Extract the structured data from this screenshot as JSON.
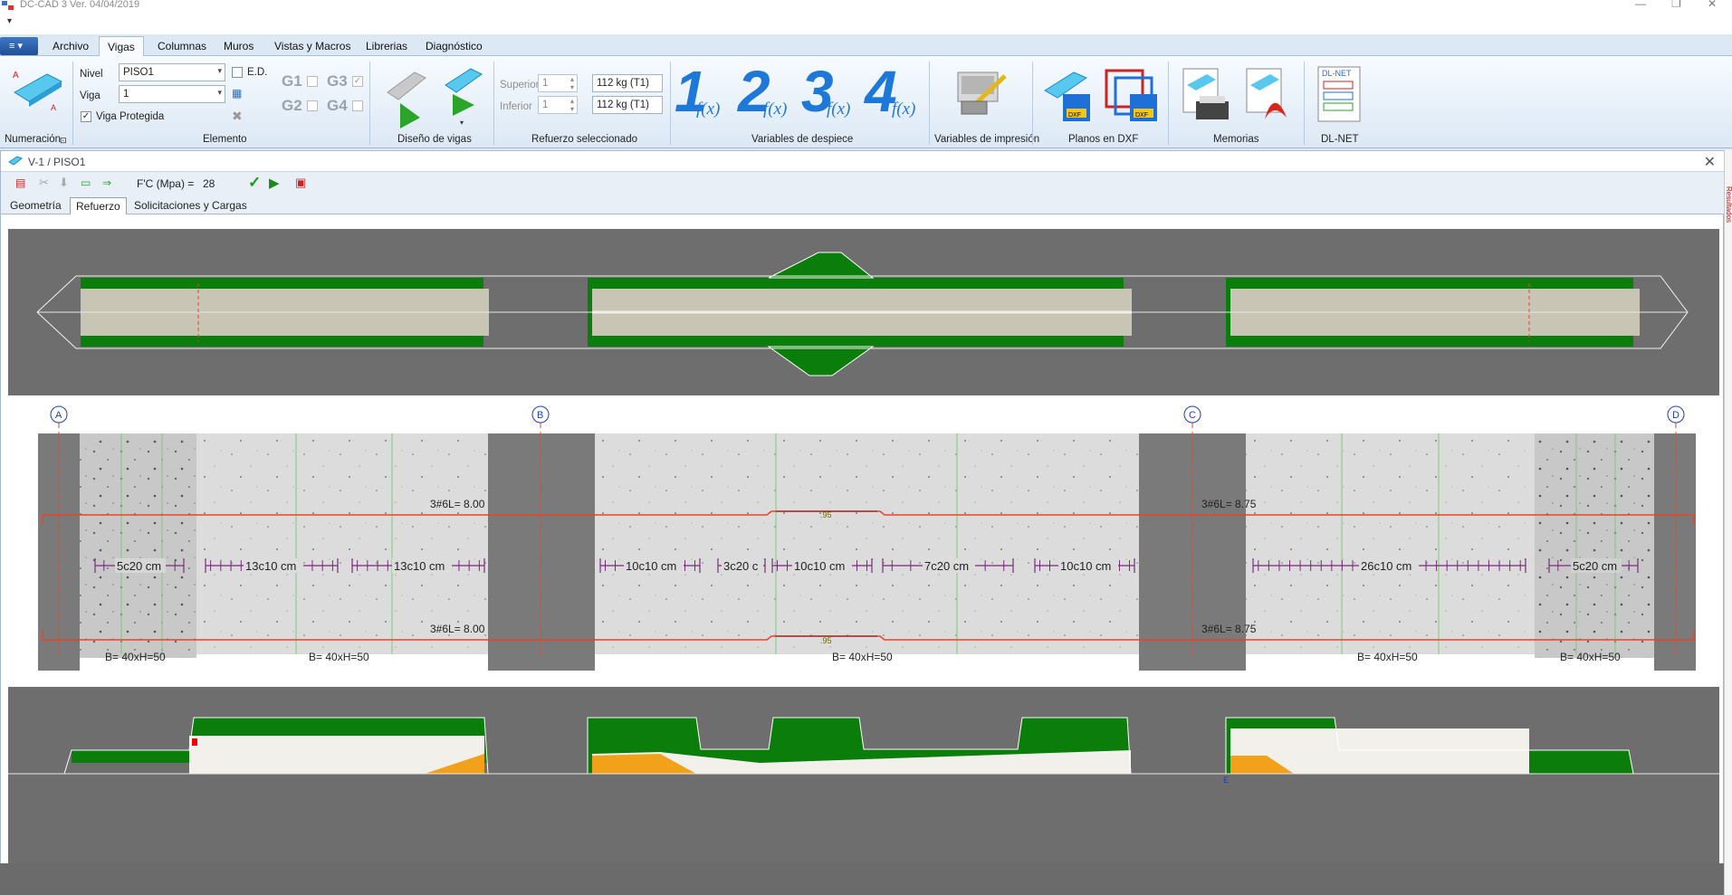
{
  "titlebar": {
    "title": "DC-CAD 3 Ver. 04/04/2019"
  },
  "ribbon": {
    "tabs": [
      "Archivo",
      "Vigas",
      "Columnas",
      "Muros",
      "Vistas y Macros",
      "Librerias",
      "Diagnóstico"
    ],
    "active_tab": "Vigas",
    "groups": {
      "numeracion": "Numeración",
      "elemento": "Elemento",
      "diseno": "Diseño de vigas",
      "refuerzo": "Refuerzo seleccionado",
      "despiece": "Variables de despiece",
      "impresion": "Variables de impresión",
      "dxf": "Planos en DXF",
      "memorias": "Memorias",
      "dlnet": "DL-NET"
    },
    "nivel_label": "Nivel",
    "nivel_value": "PISO1",
    "viga_label": "Viga",
    "viga_value": "1",
    "ed_label": "E.D.",
    "viga_protegida_label": "Viga Protegida",
    "g_labels": [
      "G1",
      "G2",
      "G3",
      "G4"
    ],
    "superior_label": "Superior",
    "superior_value": "1",
    "inferior_label": "Inferior",
    "inferior_value": "1",
    "superior_weight": "112 kg (T1)",
    "inferior_weight": "112 kg (T1)",
    "fx_numbers": [
      "1",
      "2",
      "3",
      "4"
    ],
    "fx_text": "f(x)",
    "dlnet_logo": "DL-NET",
    "dxf_tag": "DXF"
  },
  "document": {
    "title": "V-1  /  PISO1",
    "fc_label": "F'C (Mpa) =",
    "fc_value": "28",
    "tabs": [
      "Geometría",
      "Refuerzo",
      "Solicitaciones y Cargas"
    ],
    "active_tab": "Refuerzo",
    "side_text": "Resultados"
  },
  "drawing": {
    "axes": [
      "A",
      "B",
      "C",
      "D"
    ],
    "top_bars": [
      "3#6L= 8.00",
      "3#6L= 8.75"
    ],
    "bottom_bars": [
      "3#6L= 8.00",
      "3#6L= 8.75"
    ],
    "splice_label": ".95",
    "stirrups": [
      "5c20 cm",
      "13c10 cm",
      "13c10 cm",
      "10c10 cm",
      "3c20 c",
      "10c10 cm",
      "7c20 cm",
      "10c10 cm",
      "26c10 cm",
      "5c20 cm"
    ],
    "sections": [
      "B= 40xH=50",
      "B= 40xH=50",
      "B= 40xH=50",
      "B= 40xH=50",
      "B= 40xH=50"
    ],
    "bottom_marker": "E"
  },
  "colors": {
    "ribbon_blue": "#1e6fd6",
    "rebar_red": "#e8452a",
    "stirrup_purple": "#7a2a7a",
    "green_fill": "#0a7d0a",
    "orange_fill": "#f2a11a",
    "gray_support": "#7a7a7a"
  }
}
